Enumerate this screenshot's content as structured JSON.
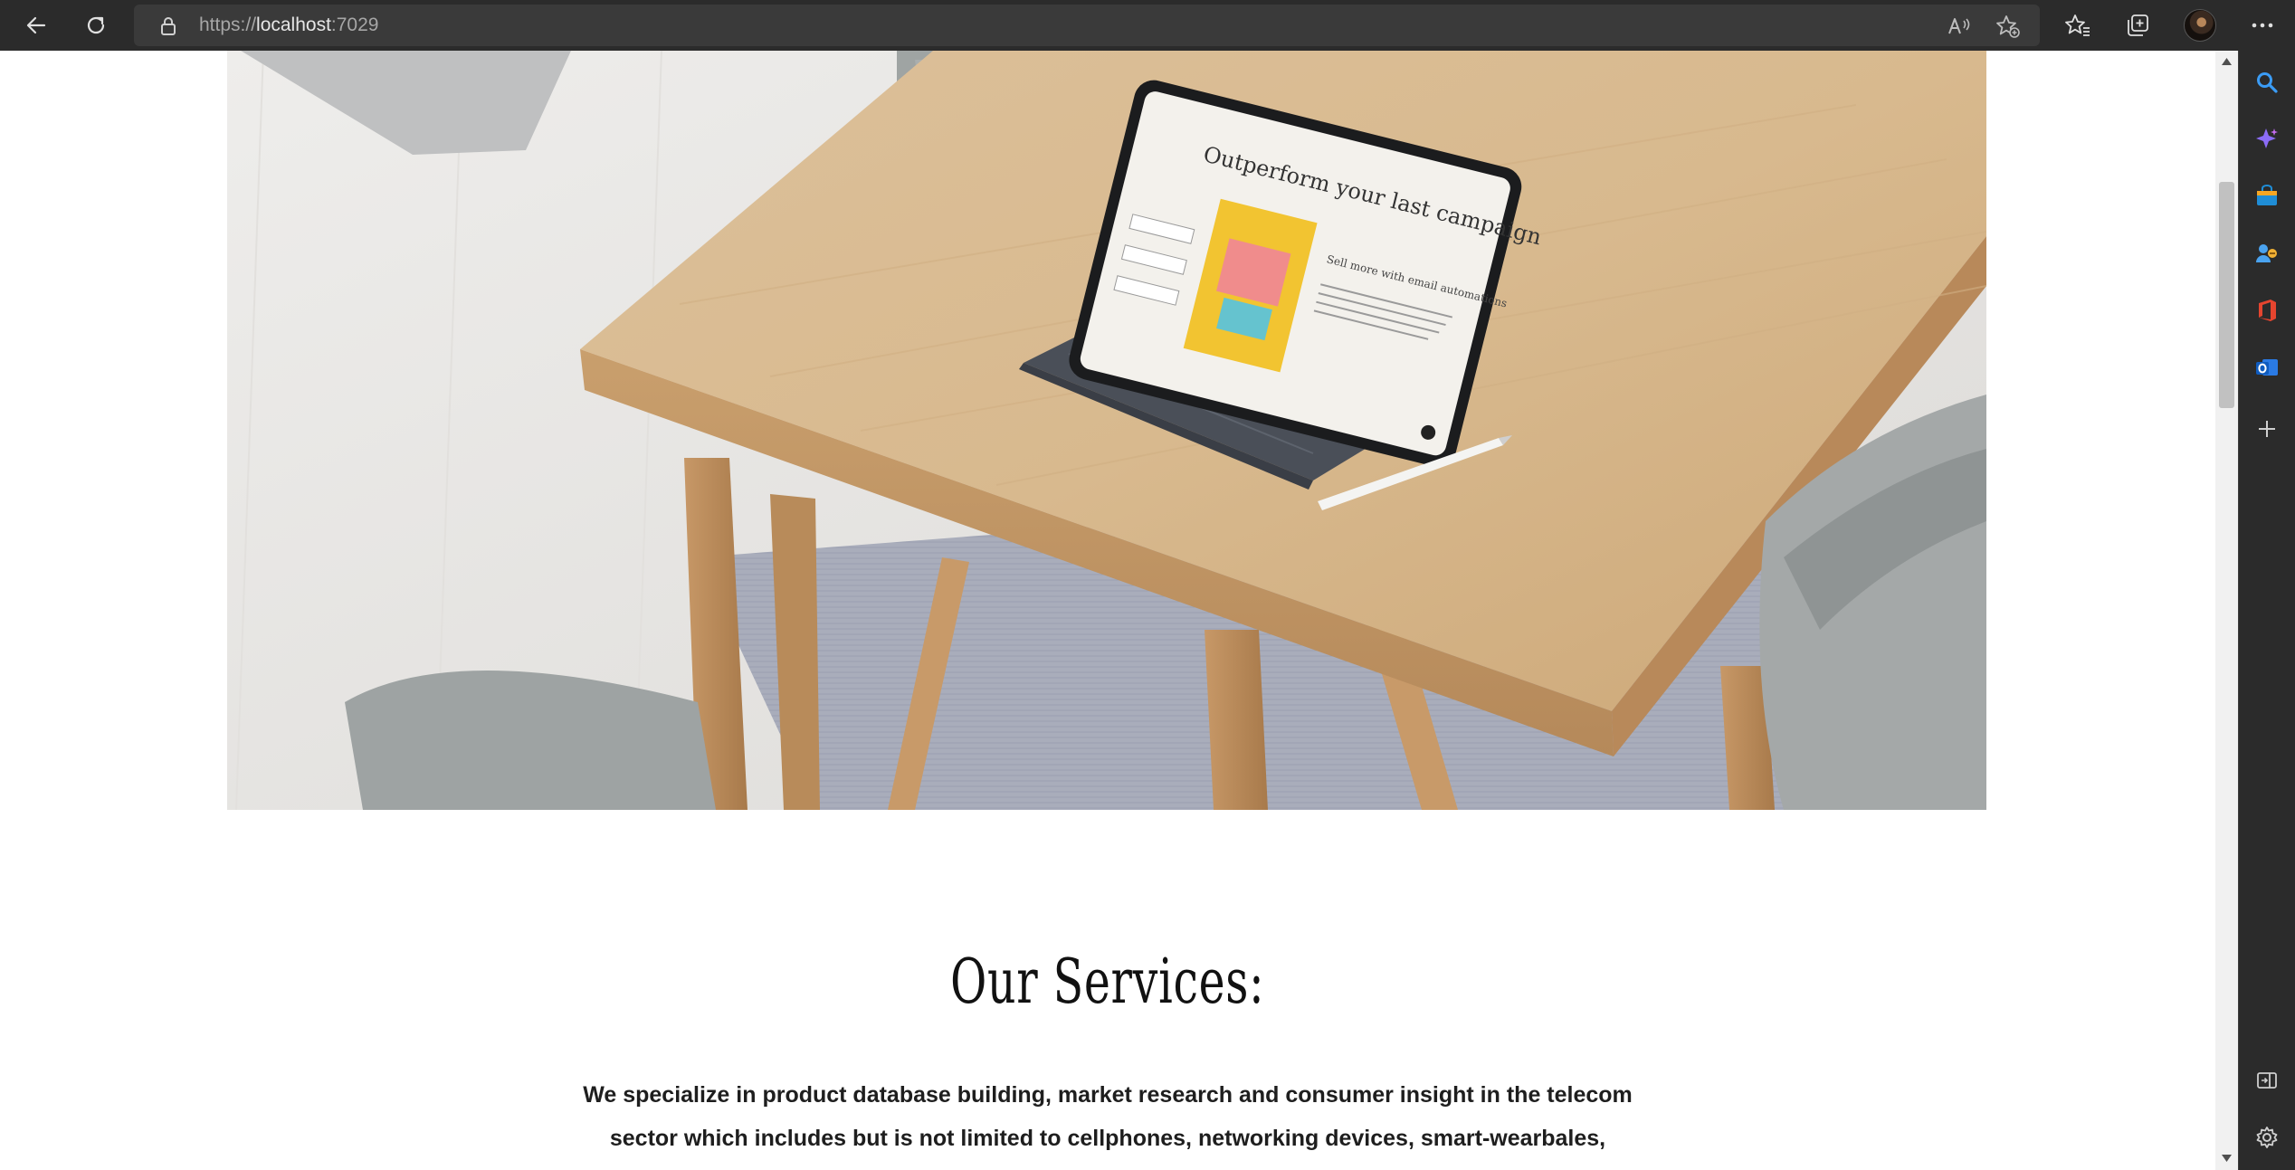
{
  "browser": {
    "url_scheme": "https://",
    "url_host": "localhost",
    "url_port": ":7029"
  },
  "icons": {
    "toolbar": [
      "back-arrow-icon",
      "refresh-icon",
      "lock-icon",
      "read-aloud-icon",
      "add-favorite-icon",
      "favorites-icon",
      "collections-icon",
      "profile-avatar",
      "more-icon"
    ],
    "sidebar": [
      "search-icon",
      "copilot-icon",
      "shopping-icon",
      "people-icon",
      "office-icon",
      "outlook-icon",
      "add-icon",
      "split-screen-icon",
      "settings-icon"
    ]
  },
  "page": {
    "services_title": "Our Services:",
    "services_line_1": "We specialize in product database building, market research and consumer insight in the telecom",
    "services_line_2": "sector which includes but is not limited to cellphones, networking devices, smart-wearbales,"
  },
  "hero_image": {
    "screen_headline": "Outperform your last campaign",
    "screen_subhead": "Sell more with email automations"
  },
  "colors": {
    "toolbar_bg": "#2b2b2b",
    "address_bg": "#3a3a3a",
    "page_bg": "#ffffff",
    "text": "#1e1e1e"
  }
}
